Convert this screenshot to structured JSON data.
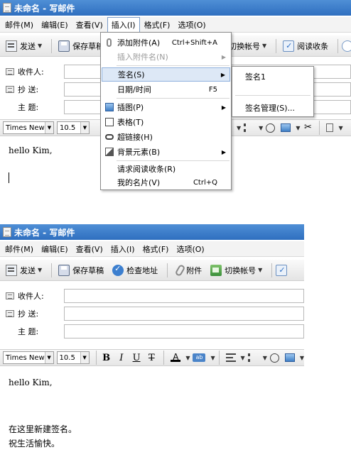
{
  "window": {
    "title": "未命名 - 写邮件"
  },
  "menubar": {
    "items": [
      "邮件(M)",
      "编辑(E)",
      "查看(V)",
      "插入(I)",
      "格式(F)",
      "选项(O)"
    ]
  },
  "toolbar": {
    "send": "发送",
    "save_draft": "保存草稿",
    "check_address": "检查地址",
    "attach": "附件",
    "switch_account": "切换帐号",
    "read_receipt": "阅读收条"
  },
  "fields": {
    "to": "收件人:",
    "cc": "抄    送:",
    "subject": "主    题:"
  },
  "format": {
    "font": "Times New R",
    "size": "10.5",
    "bold": "B",
    "italic": "I",
    "underline": "U",
    "strike": "T",
    "font_color": "A",
    "highlight": "ab"
  },
  "insert_menu": {
    "attach_file": "添加附件(A)",
    "attach_file_shortcut": "Ctrl+Shift+A",
    "insert_attachment_name": "插入附件名(N)",
    "signature": "签名(S)",
    "datetime": "日期/时间",
    "datetime_shortcut": "F5",
    "picture": "插图(P)",
    "table": "表格(T)",
    "hyperlink": "超链接(H)",
    "background": "背景元素(B)",
    "request_receipt": "请求阅读收条(R)",
    "my_card": "我的名片(V)",
    "my_card_shortcut": "Ctrl+Q"
  },
  "signature_submenu": {
    "item1": "签名1",
    "manage": "签名管理(S)..."
  },
  "editor1": {
    "line1": "hello Kim,"
  },
  "editor2": {
    "line1": "hello Kim,",
    "line2": "在这里新建签名。",
    "line3": "祝生活愉快。"
  }
}
